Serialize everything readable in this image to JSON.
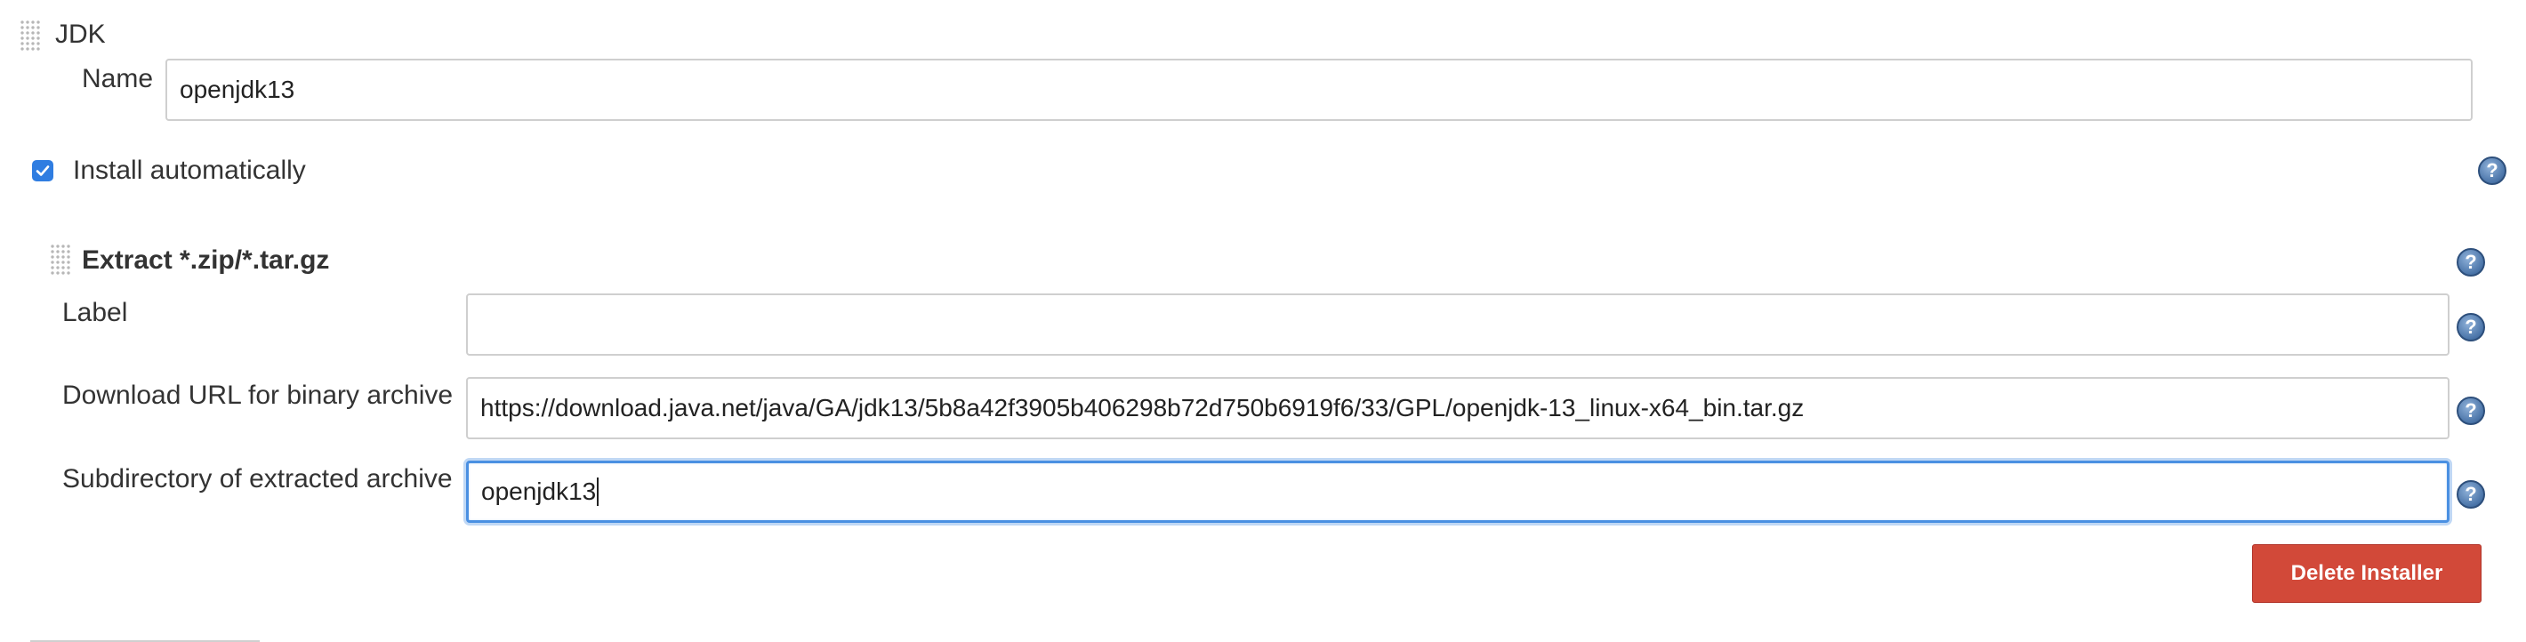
{
  "jdk": {
    "section_title": "JDK",
    "name_label": "Name",
    "name_value": "openjdk13"
  },
  "install": {
    "checkbox_label": "Install automatically",
    "checked": true
  },
  "installer": {
    "title": "Extract *.zip/*.tar.gz",
    "label_label": "Label",
    "label_value": "",
    "download_url_label": "Download URL for binary archive",
    "download_url_value": "https://download.java.net/java/GA/jdk13/5b8a42f3905b406298b72d750b6919f6/33/GPL/openjdk-13_linux-x64_bin.tar.gz",
    "subdirectory_label": "Subdirectory of extracted archive",
    "subdirectory_value": "openjdk13",
    "delete_label": "Delete Installer"
  },
  "help_icon_glyph": "?",
  "colors": {
    "focus": "#4a90e2",
    "checkbox": "#2f7de1",
    "delete_button": "#d24939",
    "help_icon": "#4a74a8"
  }
}
